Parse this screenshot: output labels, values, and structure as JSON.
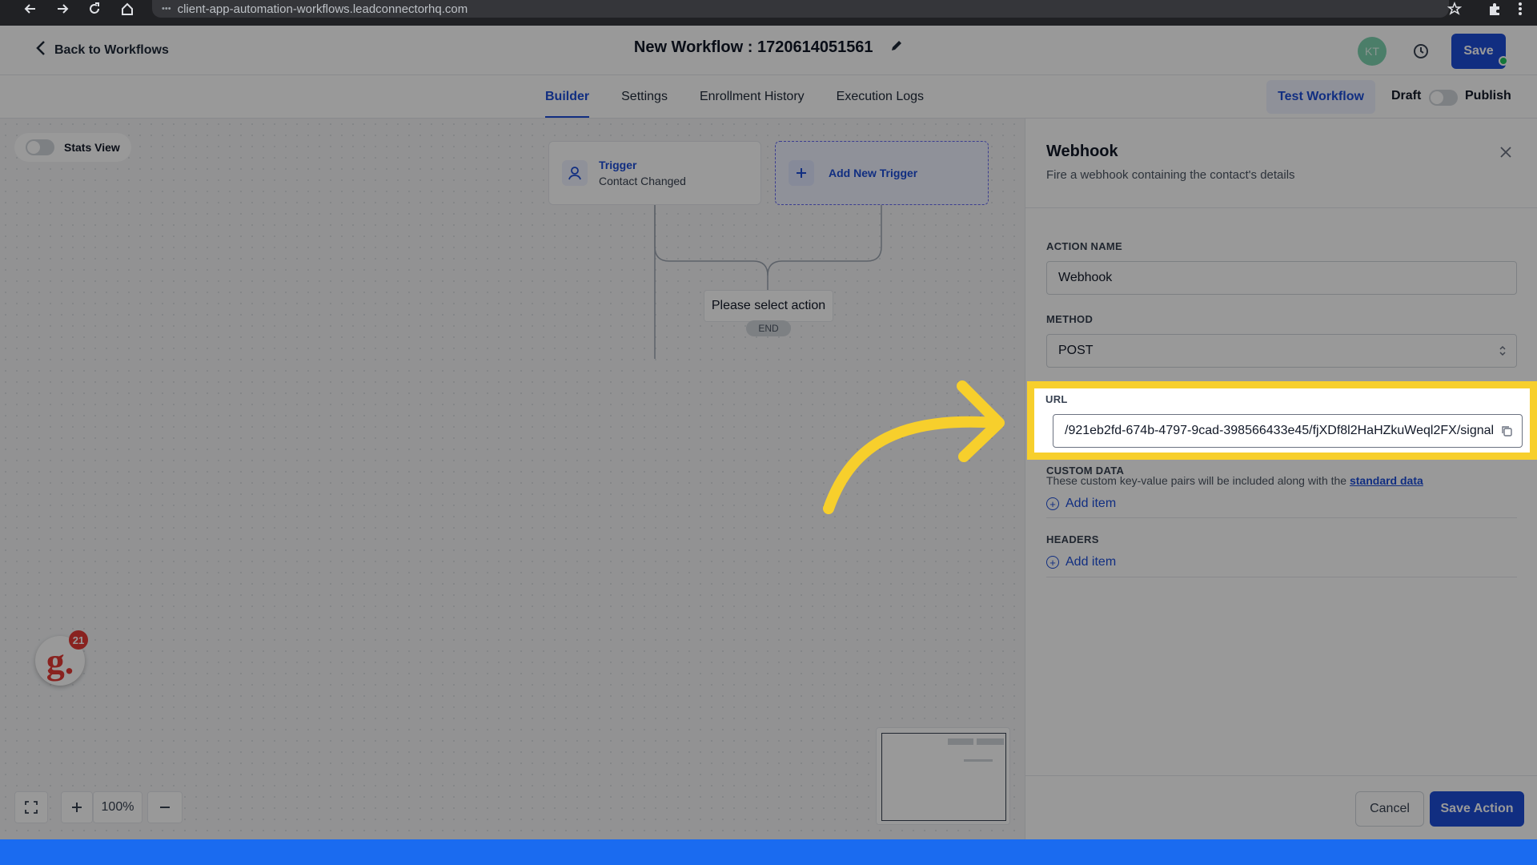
{
  "browser": {
    "url": "client-app-automation-workflows.leadconnectorhq.com"
  },
  "header": {
    "back_label": "Back to Workflows",
    "title": "New Workflow : 1720614051561",
    "avatar_initials": "KT",
    "save_label": "Save"
  },
  "tabs": [
    {
      "label": "Builder",
      "active": true
    },
    {
      "label": "Settings",
      "active": false
    },
    {
      "label": "Enrollment History",
      "active": false
    },
    {
      "label": "Execution Logs",
      "active": false
    }
  ],
  "toolbar": {
    "test_label": "Test Workflow",
    "draft_label": "Draft",
    "publish_label": "Publish"
  },
  "canvas": {
    "stats_label": "Stats View",
    "trigger_title": "Trigger",
    "trigger_sub": "Contact Changed",
    "add_trigger_label": "Add New Trigger",
    "select_action_label": "Please select action",
    "end_label": "END",
    "zoom_level": "100%",
    "notification_count": "21",
    "logo_letter": "g."
  },
  "panel": {
    "title": "Webhook",
    "subtitle": "Fire a webhook containing the contact's details",
    "action_name_label": "ACTION NAME",
    "action_name_value": "Webhook",
    "method_label": "METHOD",
    "method_value": "POST",
    "url_label": "URL",
    "url_value": "/921eb2fd-674b-4797-9cad-398566433e45/fjXDf8l2HaHZkuWeql2FX/signal",
    "custom_data_label": "CUSTOM DATA",
    "custom_data_help": "These custom key-value pairs will be included along with the",
    "custom_data_link": "standard data",
    "add_item_label": "Add item",
    "headers_label": "HEADERS",
    "cancel_label": "Cancel",
    "save_action_label": "Save Action"
  },
  "colors": {
    "accent": "#1d4ed8",
    "highlight": "#f7cf2c",
    "bottom_bar": "#1a6bf0"
  }
}
